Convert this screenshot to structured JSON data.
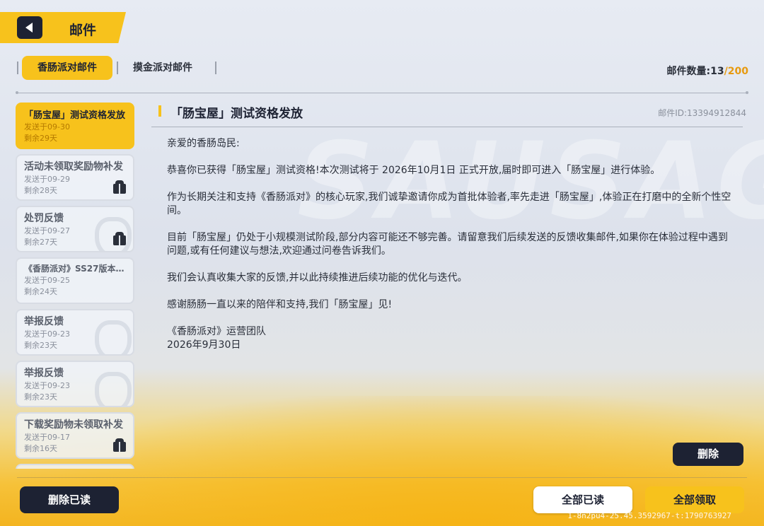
{
  "header": {
    "title": "邮件"
  },
  "tabs": [
    {
      "label": "香肠派对邮件",
      "active": true
    },
    {
      "label": "摸金派对邮件",
      "active": false
    }
  ],
  "mail_count": {
    "label": "邮件数量:",
    "current": "13",
    "sep": "/",
    "max": "200"
  },
  "mails": [
    {
      "title": "「肠宝屋」测试资格发放",
      "sent": "发送于09-30",
      "remain": "剩余29天",
      "active": true
    },
    {
      "title": "活动未领取奖励物补发",
      "sent": "发送于09-29",
      "remain": "剩余28天",
      "icon": "gift-icon"
    },
    {
      "title": "处罚反馈",
      "sent": "发送于09-27",
      "remain": "剩余27天",
      "icon": "gift-icon"
    },
    {
      "title": "《香肠派对》SS27版本…",
      "sent": "发送于09-25",
      "remain": "剩余24天"
    },
    {
      "title": "举报反馈",
      "sent": "发送于09-23",
      "remain": "剩余23天"
    },
    {
      "title": "举报反馈",
      "sent": "发送于09-23",
      "remain": "剩余23天"
    },
    {
      "title": "下载奖励物未领取补发",
      "sent": "发送于09-17",
      "remain": "剩余16天",
      "icon": "gift-icon"
    }
  ],
  "detail": {
    "title": "「肠宝屋」测试资格发放",
    "mail_id": "邮件ID:13394912844",
    "greeting": "亲爱的香肠岛民:",
    "p1": "恭喜你已获得「肠宝屋」测试资格!本次测试将于 2026年10月1日 正式开放,届时即可进入「肠宝屋」进行体验。",
    "p2": "作为长期关注和支持《香肠派对》的核心玩家,我们诚挚邀请你成为首批体验者,率先走进「肠宝屋」,体验正在打磨中的全新个性空间。",
    "p3": "目前「肠宝屋」仍处于小规模测试阶段,部分内容可能还不够完善。请留意我们后续发送的反馈收集邮件,如果你在体验过程中遇到问题,或有任何建议与想法,欢迎通过问卷告诉我们。",
    "p4": "我们会认真收集大家的反馈,并以此持续推进后续功能的优化与迭代。",
    "p5": "感谢肠肠一直以来的陪伴和支持,我们「肠宝屋」见!",
    "sign": "《香肠派对》运营团队",
    "date": "2026年9月30日"
  },
  "buttons": {
    "delete": "删除",
    "delete_read": "删除已读",
    "read_all": "全部已读",
    "claim_all": "全部领取"
  },
  "watermark": "1-8n2pu4-25.45.3592967-t:1790763927",
  "colors": {
    "accent": "#f7c21c",
    "dark": "#1d2233",
    "max_count": "#e79a10"
  }
}
